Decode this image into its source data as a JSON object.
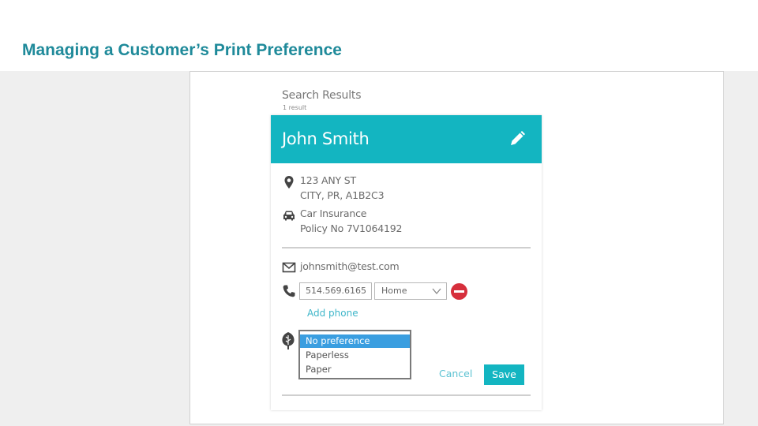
{
  "slide": {
    "title": "Managing a Customer’s Print Preference"
  },
  "search": {
    "heading": "Search Results",
    "count": "1 result"
  },
  "customer": {
    "name": "John Smith",
    "address_line1": "123 ANY ST",
    "address_line2": "CITY, PR, A1B2C3",
    "policy_type": "Car Insurance",
    "policy_number": "Policy No 7V1064192",
    "email": "johnsmith@test.com",
    "phone": "514.569.6165",
    "phone_type": "Home",
    "add_phone_label": "Add phone"
  },
  "print_preference": {
    "options": [
      "No preference",
      "Paperless",
      "Paper"
    ],
    "selected": "No preference"
  },
  "actions": {
    "cancel_label": "Cancel",
    "save_label": "Save"
  },
  "colors": {
    "brand_teal": "#13b5c1",
    "title_teal": "#1f8a9a",
    "remove_red": "#d62f3c",
    "selection_blue": "#3a9ee0",
    "link_teal": "#3eb6c9"
  },
  "icons": [
    "edit-icon",
    "location-pin-icon",
    "car-icon",
    "envelope-icon",
    "phone-icon",
    "chevron-down-icon",
    "remove-icon",
    "tree-icon"
  ]
}
